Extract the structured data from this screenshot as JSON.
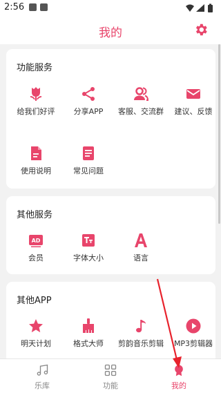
{
  "status": {
    "time": "2:56"
  },
  "header": {
    "title": "我的"
  },
  "sections": {
    "func": {
      "title": "功能服务",
      "items": [
        {
          "label": "给我们好评",
          "icon": "tulip-icon"
        },
        {
          "label": "分享APP",
          "icon": "share-icon"
        },
        {
          "label": "客服、交流群",
          "icon": "users-icon"
        },
        {
          "label": "建议、反馈",
          "icon": "mail-icon"
        },
        {
          "label": "使用说明",
          "icon": "document-icon"
        },
        {
          "label": "常见问题",
          "icon": "list-document-icon"
        }
      ]
    },
    "other": {
      "title": "其他服务",
      "items": [
        {
          "label": "会员",
          "icon": "ad-icon"
        },
        {
          "label": "字体大小",
          "icon": "text-size-icon"
        },
        {
          "label": "语言",
          "icon": "letter-a-icon"
        }
      ]
    },
    "apps": {
      "title": "其他APP",
      "items": [
        {
          "label": "明天计划",
          "icon": "star-icon"
        },
        {
          "label": "格式大师",
          "icon": "brush-icon"
        },
        {
          "label": "剪韵音乐剪辑",
          "icon": "music-note-icon"
        },
        {
          "label": "MP3剪辑器",
          "icon": "play-circle-icon"
        }
      ]
    }
  },
  "nav": {
    "tabs": [
      {
        "label": "乐库",
        "icon": "music-library-icon"
      },
      {
        "label": "功能",
        "icon": "grid-icon"
      },
      {
        "label": "我的",
        "icon": "profile-icon",
        "active": true
      }
    ]
  },
  "colors": {
    "accent": "#e8456b",
    "annotation": "#e8222c"
  }
}
